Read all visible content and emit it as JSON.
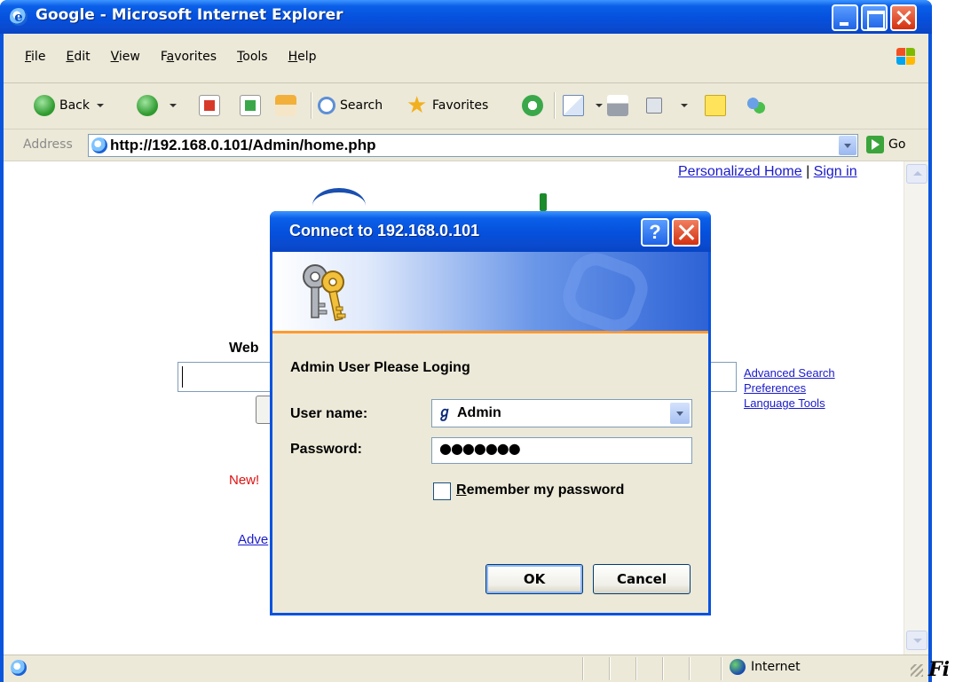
{
  "window": {
    "title": "Google - Microsoft Internet Explorer"
  },
  "menu": {
    "items": [
      {
        "accel": "F",
        "rest": "ile"
      },
      {
        "accel": "E",
        "rest": "dit"
      },
      {
        "accel": "V",
        "rest": "iew"
      },
      {
        "accel": "a",
        "pre": "F",
        "rest": "vorites"
      },
      {
        "accel": "T",
        "rest": "ools"
      },
      {
        "accel": "H",
        "rest": "elp"
      }
    ]
  },
  "toolbar": {
    "back_label": "Back",
    "search_label": "Search",
    "favorites_label": "Favorites"
  },
  "address": {
    "label": "Address",
    "url": "http://192.168.0.101/Admin/home.php",
    "go_label": "Go"
  },
  "page": {
    "personalized_home": "Personalized Home",
    "separator": " | ",
    "sign_in": "Sign in",
    "web_label": "Web",
    "advanced_search": "Advanced Search",
    "preferences": "Preferences",
    "language_tools": "Language Tools",
    "new_label": "New!",
    "adv_fragment": "Adve"
  },
  "status": {
    "zone": "Internet"
  },
  "caption_fragment": "Fi",
  "dialog": {
    "title": "Connect to  192.168.0.101",
    "help_label": "?",
    "prompt": "Admin User Please Loging",
    "username_label": "User name:",
    "username_value": "Admin",
    "password_label": "Password:",
    "password_mask": "●●●●●●●",
    "remember_accel": "R",
    "remember_rest": "emember my password",
    "ok_label": "OK",
    "cancel_label": "Cancel"
  },
  "colors": {
    "titlebar_blue": "#0550dc",
    "link_blue": "#1a1acc",
    "new_red": "#e01010",
    "banner_accent": "#ff9a30"
  }
}
